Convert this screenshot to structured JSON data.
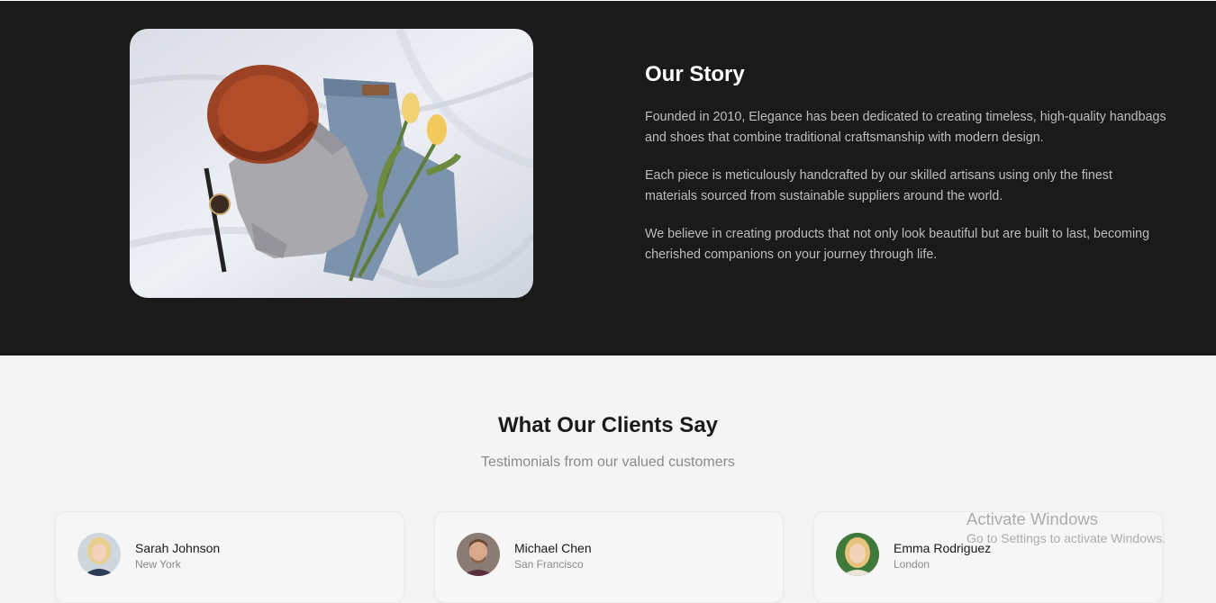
{
  "story": {
    "title": "Our Story",
    "paragraphs": [
      "Founded in 2010, Elegance has been dedicated to creating timeless, high-quality handbags and shoes that combine traditional craftsmanship with modern design.",
      "Each piece is meticulously handcrafted by our skilled artisans using only the finest materials sourced from sustainable suppliers around the world.",
      "We believe in creating products that not only look beautiful but are built to last, becoming cherished companions on your journey through life."
    ],
    "colors": {
      "background": "#1a1a1a",
      "title": "#ffffff",
      "text": "#bdbdbd"
    }
  },
  "testimonials": {
    "title": "What Our Clients Say",
    "subtitle": "Testimonials from our valued customers",
    "clients": [
      {
        "name": "Sarah Johnson",
        "location": "New York"
      },
      {
        "name": "Michael Chen",
        "location": "San Francisco"
      },
      {
        "name": "Emma Rodriguez",
        "location": "London"
      }
    ]
  },
  "watermark": {
    "title": "Activate Windows",
    "subtitle": "Go to Settings to activate Windows."
  }
}
